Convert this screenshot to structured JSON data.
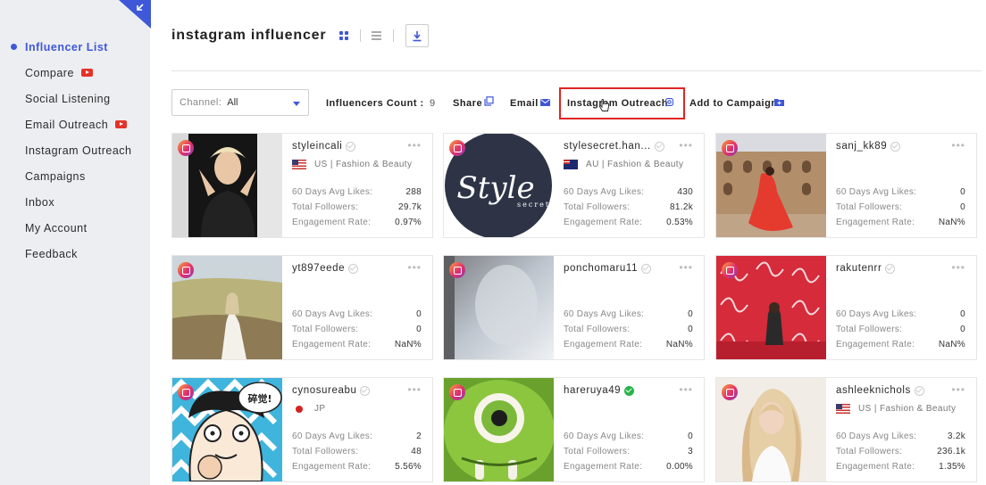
{
  "sidebar": {
    "items": [
      {
        "label": "Influencer List",
        "active": true,
        "video": false
      },
      {
        "label": "Compare",
        "active": false,
        "video": true
      },
      {
        "label": "Social Listening",
        "active": false,
        "video": false
      },
      {
        "label": "Email Outreach",
        "active": false,
        "video": true
      },
      {
        "label": "Instagram Outreach",
        "active": false,
        "video": false
      },
      {
        "label": "Campaigns",
        "active": false,
        "video": false
      },
      {
        "label": "Inbox",
        "active": false,
        "video": false
      },
      {
        "label": "My Account",
        "active": false,
        "video": false
      },
      {
        "label": "Feedback",
        "active": false,
        "video": false
      }
    ]
  },
  "header": {
    "title": "instagram influencer"
  },
  "toolbar": {
    "channel_label": "Channel:",
    "channel_value": "All",
    "count_label": "Influencers Count :",
    "count_value": "9",
    "share_label": "Share",
    "email_label": "Email",
    "outreach_label": "Instagram Outreach",
    "campaign_label": "Add to Campaign"
  },
  "stat_labels": {
    "likes": "60 Days Avg Likes:",
    "followers": "Total Followers:",
    "engagement": "Engagement Rate:"
  },
  "cards": [
    {
      "name": "styleincali",
      "verified": "grey",
      "flag": "us",
      "location": "US | Fashion & Beauty",
      "likes": "288",
      "followers": "29.7k",
      "engagement": "0.97%"
    },
    {
      "name": "stylesecret.han...",
      "verified": "grey",
      "flag": "au",
      "location": "AU | Fashion & Beauty",
      "likes": "430",
      "followers": "81.2k",
      "engagement": "0.53%"
    },
    {
      "name": "sanj_kk89",
      "verified": "grey",
      "flag": "",
      "location": "",
      "likes": "0",
      "followers": "0",
      "engagement": "NaN%"
    },
    {
      "name": "yt897eede",
      "verified": "grey",
      "flag": "",
      "location": "",
      "likes": "0",
      "followers": "0",
      "engagement": "NaN%"
    },
    {
      "name": "ponchomaru11",
      "verified": "grey",
      "flag": "",
      "location": "",
      "likes": "0",
      "followers": "0",
      "engagement": "NaN%"
    },
    {
      "name": "rakutenrr",
      "verified": "grey",
      "flag": "",
      "location": "",
      "likes": "0",
      "followers": "0",
      "engagement": "NaN%"
    },
    {
      "name": "cynosureabu",
      "verified": "grey",
      "flag": "jp",
      "location": "JP",
      "likes": "2",
      "followers": "48",
      "engagement": "5.56%"
    },
    {
      "name": "hareruya49",
      "verified": "green",
      "flag": "",
      "location": "",
      "likes": "0",
      "followers": "3",
      "engagement": "0.00%"
    },
    {
      "name": "ashleeknichols",
      "verified": "grey",
      "flag": "us",
      "location": "US | Fashion & Beauty",
      "likes": "3.2k",
      "followers": "236.1k",
      "engagement": "1.35%"
    }
  ],
  "thumb_text": {
    "style_main": "Style",
    "style_sub": "secret",
    "bubble": "碎觉!"
  },
  "colors": {
    "accent": "#3f58d8",
    "highlight_box": "#e02424",
    "video_badge": "#e53228",
    "verified_green": "#27b44b"
  }
}
